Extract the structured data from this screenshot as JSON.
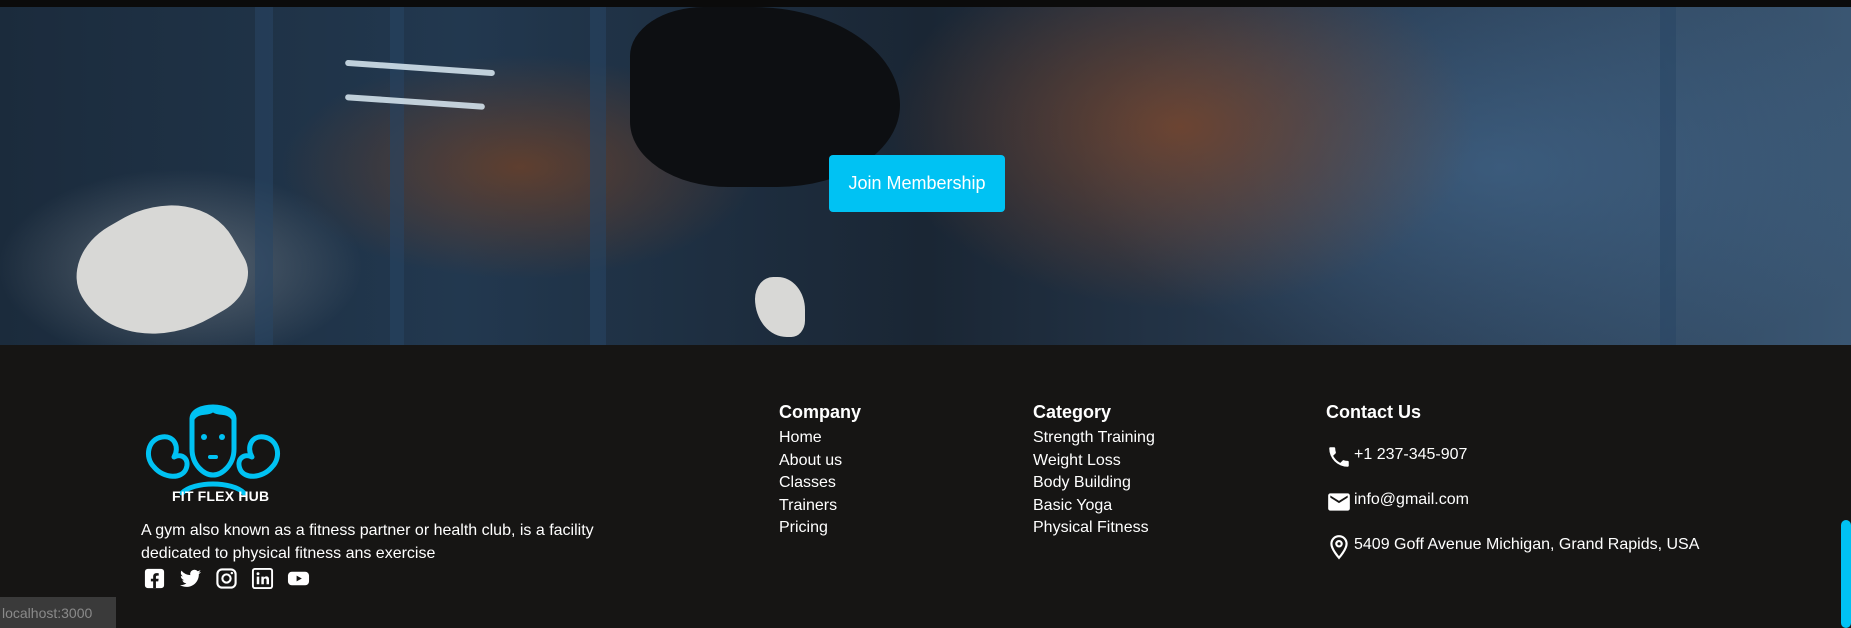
{
  "hero": {
    "cta_label": "Join Membership"
  },
  "footer": {
    "logo_text": "FIT FLEX HUB",
    "about": "A gym also known as a fitness partner or health club, is a facility dedicated to physical fitness ans exercise",
    "socials": [
      "facebook-icon",
      "twitter-icon",
      "instagram-icon",
      "linkedin-icon",
      "youtube-icon"
    ],
    "company": {
      "heading": "Company",
      "links": [
        "Home",
        "About us",
        "Classes",
        "Trainers",
        "Pricing"
      ]
    },
    "category": {
      "heading": "Category",
      "links": [
        "Strength Training",
        "Weight Loss",
        "Body Building",
        "Basic Yoga",
        "Physical Fitness"
      ]
    },
    "contact": {
      "heading": "Contact Us",
      "phone": "+1 237-345-907",
      "email": "info@gmail.com",
      "address": "5409 Goff Avenue Michigan, Grand Rapids, USA"
    }
  },
  "status_url": "localhost:3000",
  "colors": {
    "accent": "#00c2f3",
    "footer_bg": "#161514",
    "text": "#ffffff"
  }
}
